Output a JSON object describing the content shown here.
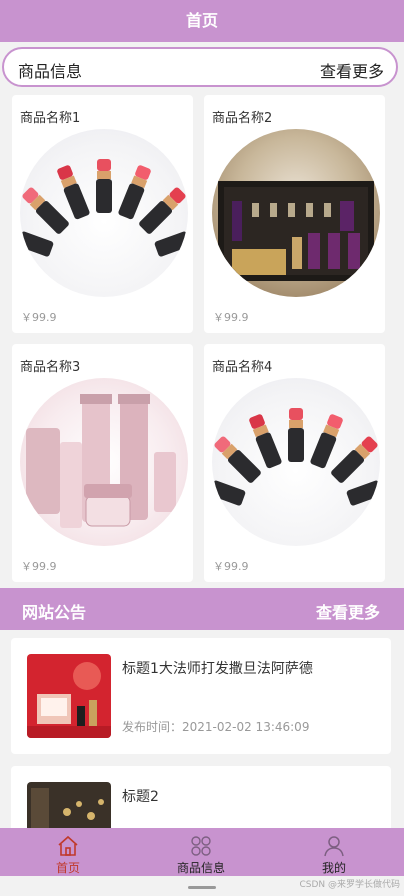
{
  "header": {
    "title": "首页"
  },
  "product_section": {
    "title": "商品信息",
    "more": "查看更多"
  },
  "products": [
    {
      "name": "商品名称1",
      "price": "￥99.9",
      "image": "lipstick-fan"
    },
    {
      "name": "商品名称2",
      "price": "￥99.9",
      "image": "cosmetic-gift-box"
    },
    {
      "name": "商品名称3",
      "price": "￥99.9",
      "image": "pink-skincare-set"
    },
    {
      "name": "商品名称4",
      "price": "￥99.9",
      "image": "lipstick-fan"
    }
  ],
  "notice_section": {
    "title": "网站公告",
    "more": "查看更多"
  },
  "notices": [
    {
      "title": "标题1大法师打发撒旦法阿萨德",
      "time": "发布时间：2021-02-02 13:46:09"
    },
    {
      "title": "标题2"
    }
  ],
  "tabs": [
    {
      "label": "首页",
      "icon": "home-icon",
      "active": true
    },
    {
      "label": "商品信息",
      "icon": "grid-icon",
      "active": false
    },
    {
      "label": "我的",
      "icon": "user-icon",
      "active": false
    }
  ],
  "watermark": "CSDN @来罗学长做代码",
  "colors": {
    "accent": "#c893cf",
    "active_tab": "#c0392b"
  }
}
